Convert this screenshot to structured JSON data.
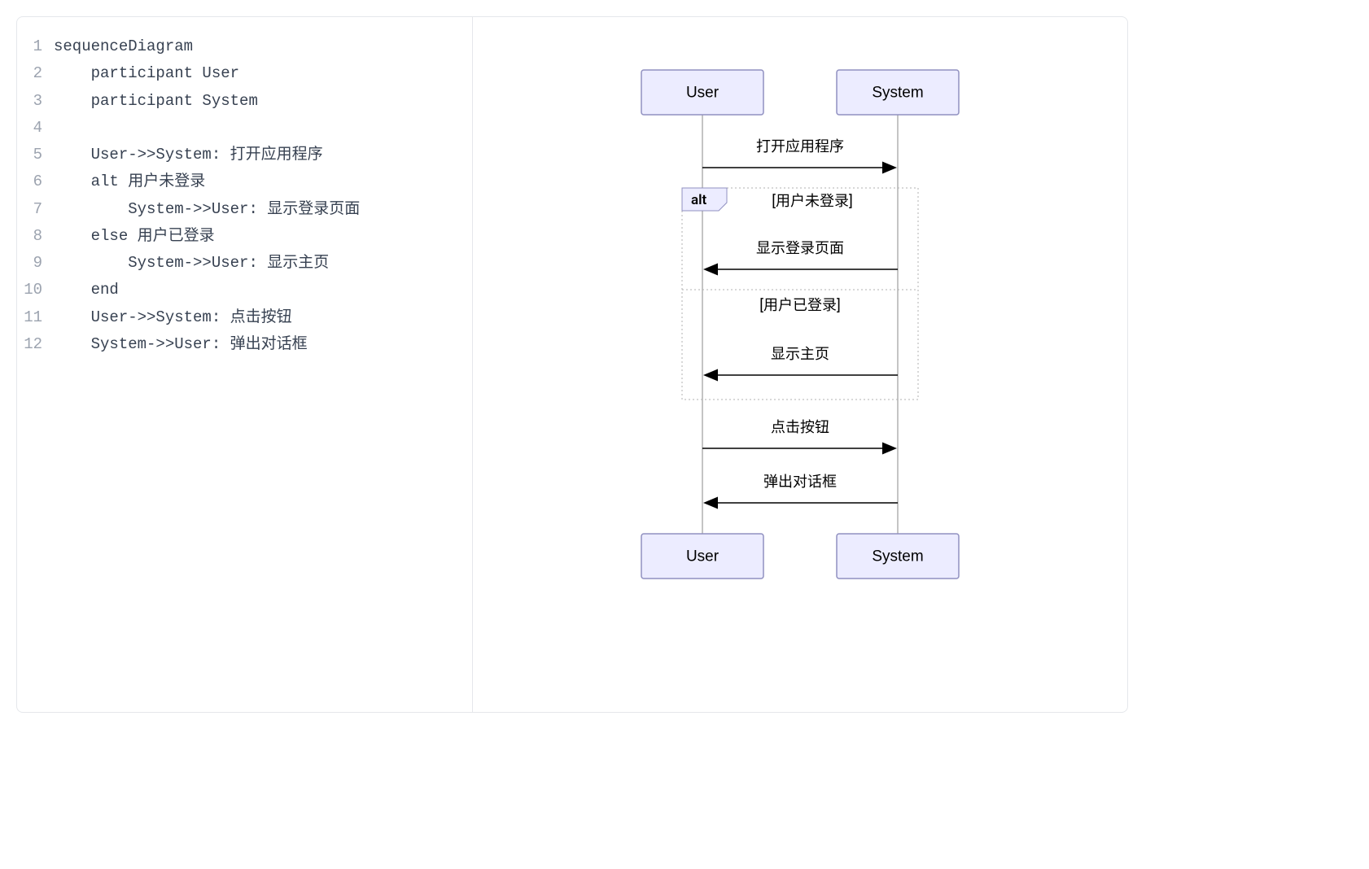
{
  "code": {
    "lines": [
      {
        "no": "1",
        "text": "sequenceDiagram"
      },
      {
        "no": "2",
        "text": "    participant User"
      },
      {
        "no": "3",
        "text": "    participant System"
      },
      {
        "no": "4",
        "text": ""
      },
      {
        "no": "5",
        "text": "    User->>System: 打开应用程序"
      },
      {
        "no": "6",
        "text": "    alt 用户未登录"
      },
      {
        "no": "7",
        "text": "        System->>User: 显示登录页面"
      },
      {
        "no": "8",
        "text": "    else 用户已登录"
      },
      {
        "no": "9",
        "text": "        System->>User: 显示主页"
      },
      {
        "no": "10",
        "text": "    end"
      },
      {
        "no": "11",
        "text": "    User->>System: 点击按钮"
      },
      {
        "no": "12",
        "text": "    System->>User: 弹出对话框"
      }
    ]
  },
  "diagram": {
    "participants": {
      "user": "User",
      "system": "System"
    },
    "messages": {
      "m1": "打开应用程序",
      "m2": "显示登录页面",
      "m3": "显示主页",
      "m4": "点击按钮",
      "m5": "弹出对话框"
    },
    "alt": {
      "label": "alt",
      "cond1": "[用户未登录]",
      "cond2": "[用户已登录]"
    }
  }
}
